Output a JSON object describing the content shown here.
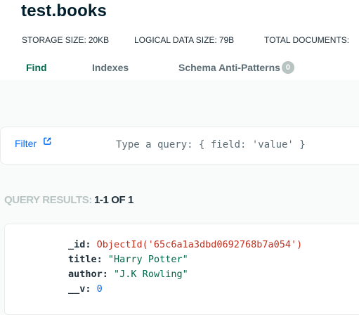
{
  "namespace": "test.books",
  "stats": {
    "storage_label": "STORAGE SIZE:",
    "storage_value": "20KB",
    "logical_label": "LOGICAL DATA SIZE:",
    "logical_value": "79B",
    "total_docs_label": "TOTAL DOCUMENTS:"
  },
  "tabs": [
    {
      "label": "Find",
      "active": true
    },
    {
      "label": "Indexes",
      "active": false
    },
    {
      "label": "Schema Anti-Patterns",
      "badge": "0",
      "active": false
    }
  ],
  "filter": {
    "label": "Filter",
    "icon": "external-link-icon",
    "placeholder": "Type a query: { field: 'value' }"
  },
  "results": {
    "label": "QUERY RESULTS:",
    "count": "1-1 OF 1"
  },
  "document": {
    "fields": [
      {
        "key": "_id:",
        "value": "ObjectId('65c6a1a3dbd0692768b7a054')",
        "type": "objectid"
      },
      {
        "key": "title:",
        "value": "\"Harry Potter\"",
        "type": "string"
      },
      {
        "key": "author:",
        "value": "\"J.K Rowling\"",
        "type": "string"
      },
      {
        "key": "__v:",
        "value": "0",
        "type": "number"
      }
    ]
  },
  "colors": {
    "accent_green": "#00684a",
    "link_blue": "#016bf8",
    "objectid_red": "#c22e1c",
    "muted_gray": "#b8c4c2"
  }
}
